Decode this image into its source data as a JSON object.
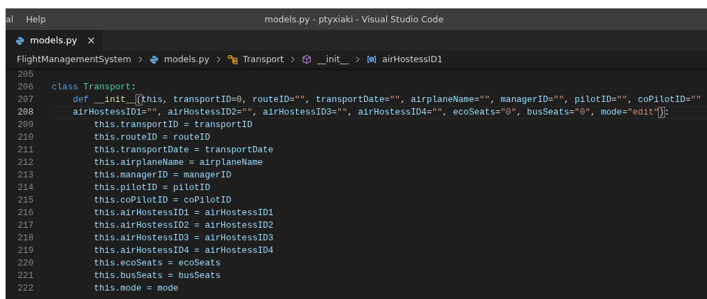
{
  "menu": [
    "al",
    "Help"
  ],
  "window": {
    "title": "models.py - ptyxiaki - Visual Studio Code"
  },
  "tabs": [
    {
      "label": "models.py",
      "selected": true,
      "close": "×"
    }
  ],
  "breadcrumbs": [
    {
      "kind": "folder",
      "label": "FlightManagementSystem"
    },
    {
      "kind": "file",
      "label": "models.py"
    },
    {
      "kind": "class",
      "label": "Transport"
    },
    {
      "kind": "method",
      "label": "__init__"
    },
    {
      "kind": "field",
      "label": "airHostessID1"
    }
  ],
  "editor": {
    "lines": [
      {
        "number": "205",
        "current": false
      },
      {
        "number": "206",
        "current": false,
        "tokens": [
          {
            "kind": "kw",
            "text": "class "
          },
          {
            "kind": "cls",
            "text": "Transport"
          },
          {
            "kind": "op",
            "text": ":"
          }
        ]
      },
      {
        "number": "207",
        "current": false,
        "tokens": [
          {
            "kind": "kw",
            "text": "    def "
          },
          {
            "kind": "fn",
            "text": "__init__"
          },
          {
            "kind": "bracket",
            "text": "("
          },
          {
            "kind": "var",
            "text": "this"
          },
          {
            "kind": "op",
            "text": ", "
          },
          {
            "kind": "var",
            "text": "transportID"
          },
          {
            "kind": "op",
            "text": "="
          },
          {
            "kind": "num",
            "text": "0"
          },
          {
            "kind": "op",
            "text": ", "
          },
          {
            "kind": "var",
            "text": "routeID"
          },
          {
            "kind": "op",
            "text": "="
          },
          {
            "kind": "str",
            "text": "\"\""
          },
          {
            "kind": "op",
            "text": ", "
          },
          {
            "kind": "var",
            "text": "transportDate"
          },
          {
            "kind": "op",
            "text": "="
          },
          {
            "kind": "str",
            "text": "\"\""
          },
          {
            "kind": "op",
            "text": ", "
          },
          {
            "kind": "var",
            "text": "airplaneName"
          },
          {
            "kind": "op",
            "text": "="
          },
          {
            "kind": "str",
            "text": "\"\""
          },
          {
            "kind": "op",
            "text": ", "
          },
          {
            "kind": "var",
            "text": "managerID"
          },
          {
            "kind": "op",
            "text": "="
          },
          {
            "kind": "str",
            "text": "\"\""
          },
          {
            "kind": "op",
            "text": ", "
          },
          {
            "kind": "var",
            "text": "pilotID"
          },
          {
            "kind": "op",
            "text": "="
          },
          {
            "kind": "str",
            "text": "\"\""
          },
          {
            "kind": "op",
            "text": ", "
          },
          {
            "kind": "var",
            "text": "coPilotID"
          },
          {
            "kind": "op",
            "text": "="
          },
          {
            "kind": "str",
            "text": "\"\""
          }
        ]
      },
      {
        "number": "208",
        "current": true,
        "tokens": [
          {
            "kind": "var",
            "text": "    airHostessID1"
          },
          {
            "kind": "op",
            "text": "="
          },
          {
            "kind": "str",
            "text": "\"\""
          },
          {
            "kind": "op",
            "text": ", "
          },
          {
            "kind": "var",
            "text": "airHostessID2"
          },
          {
            "kind": "op",
            "text": "="
          },
          {
            "kind": "str",
            "text": "\"\""
          },
          {
            "kind": "op",
            "text": ", "
          },
          {
            "kind": "var",
            "text": "airHostessID3"
          },
          {
            "kind": "op",
            "text": "="
          },
          {
            "kind": "str",
            "text": "\"\""
          },
          {
            "kind": "op",
            "text": ", "
          },
          {
            "kind": "var",
            "text": "airHostessID4"
          },
          {
            "kind": "op",
            "text": "="
          },
          {
            "kind": "str",
            "text": "\"\""
          },
          {
            "kind": "op",
            "text": ", "
          },
          {
            "kind": "var",
            "text": "ecoSeats"
          },
          {
            "kind": "op",
            "text": "="
          },
          {
            "kind": "str",
            "text": "\"0\""
          },
          {
            "kind": "op",
            "text": ", "
          },
          {
            "kind": "var",
            "text": "busSeats"
          },
          {
            "kind": "op",
            "text": "="
          },
          {
            "kind": "str",
            "text": "\"0\""
          },
          {
            "kind": "op",
            "text": ", "
          },
          {
            "kind": "var",
            "text": "mode"
          },
          {
            "kind": "op",
            "text": "="
          },
          {
            "kind": "str",
            "text": "\"edit\""
          },
          {
            "kind": "bracket",
            "text": ")"
          },
          {
            "kind": "op",
            "text": ":"
          }
        ]
      },
      {
        "number": "209",
        "current": false,
        "tokens": [
          {
            "kind": "var",
            "text": "        this.transportID = transportID"
          }
        ]
      },
      {
        "number": "210",
        "current": false,
        "tokens": [
          {
            "kind": "var",
            "text": "        this.routeID = routeID"
          }
        ]
      },
      {
        "number": "211",
        "current": false,
        "tokens": [
          {
            "kind": "var",
            "text": "        this.transportDate = transportDate"
          }
        ]
      },
      {
        "number": "212",
        "current": false,
        "tokens": [
          {
            "kind": "var",
            "text": "        this.airplaneName = airplaneName"
          }
        ]
      },
      {
        "number": "213",
        "current": false,
        "tokens": [
          {
            "kind": "var",
            "text": "        this.managerID = managerID"
          }
        ]
      },
      {
        "number": "214",
        "current": false,
        "tokens": [
          {
            "kind": "var",
            "text": "        this.pilotID = pilotID"
          }
        ]
      },
      {
        "number": "215",
        "current": false,
        "tokens": [
          {
            "kind": "var",
            "text": "        this.coPilotID = coPilotID"
          }
        ]
      },
      {
        "number": "216",
        "current": false,
        "tokens": [
          {
            "kind": "var",
            "text": "        this.airHostessID1 = airHostessID1"
          }
        ]
      },
      {
        "number": "217",
        "current": false,
        "tokens": [
          {
            "kind": "var",
            "text": "        this.airHostessID2 = airHostessID2"
          }
        ]
      },
      {
        "number": "218",
        "current": false,
        "tokens": [
          {
            "kind": "var",
            "text": "        this.airHostessID3 = airHostessID3"
          }
        ]
      },
      {
        "number": "219",
        "current": false,
        "tokens": [
          {
            "kind": "var",
            "text": "        this.airHostessID4 = airHostessID4"
          }
        ]
      },
      {
        "number": "220",
        "current": false,
        "tokens": [
          {
            "kind": "var",
            "text": "        this.ecoSeats = ecoSeats"
          }
        ]
      },
      {
        "number": "221",
        "current": false,
        "tokens": [
          {
            "kind": "var",
            "text": "        this.busSeats = busSeats"
          }
        ]
      },
      {
        "number": "222",
        "current": false,
        "tokens": [
          {
            "kind": "var",
            "text": "        this.mode = mode"
          }
        ]
      }
    ]
  }
}
